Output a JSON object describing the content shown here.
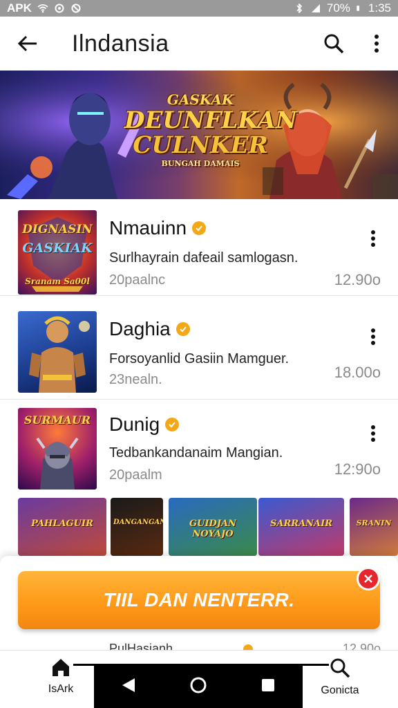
{
  "status_bar": {
    "left_text": "APK",
    "battery": "70%",
    "time": "1:35"
  },
  "app_bar": {
    "title": "Ilndansia"
  },
  "banner": {
    "line1": "GASKAK",
    "line2": "DEUNFLKAN",
    "line3": "CULNKER",
    "line4": "BUNGAH DAMAIS"
  },
  "list": [
    {
      "title": "Nmauinn",
      "description": "Surlhayrain dafeail samlogasn.",
      "meta": "20paalnc",
      "time": "12.90o",
      "thumb_text_top": "DIGNASIN",
      "thumb_text_mid": "GASKIAK",
      "thumb_text_bottom": "Sranam Sa00l"
    },
    {
      "title": "Daghia",
      "description": "Forsoyanlid Gasiin Mamguer.",
      "meta": "23nealn.",
      "time": "18.00o"
    },
    {
      "title": "Dunig",
      "description": "Tedbankandanaim Mangian.",
      "meta": "20paalm",
      "time": "12:90o",
      "thumb_text_top": "SURMAUR"
    }
  ],
  "strip": [
    {
      "label": "PAHLAGUIR"
    },
    {
      "label": "DANGANGAN"
    },
    {
      "label": "GUIDJAN NOYAJO"
    },
    {
      "label": "SARRANAIR"
    },
    {
      "label": "SRANIN"
    }
  ],
  "cta": {
    "label": "TIIL DAN NENTERR."
  },
  "peek": {
    "text": "PulHasianh",
    "time": "12.90o"
  },
  "bottom_nav": {
    "home_label": "IsArk",
    "search_label": "Gonicta"
  },
  "colors": {
    "accent": "#ff9a1a",
    "verified": "#f2a817",
    "close": "#e5262d",
    "muted": "#8a8a8a"
  }
}
